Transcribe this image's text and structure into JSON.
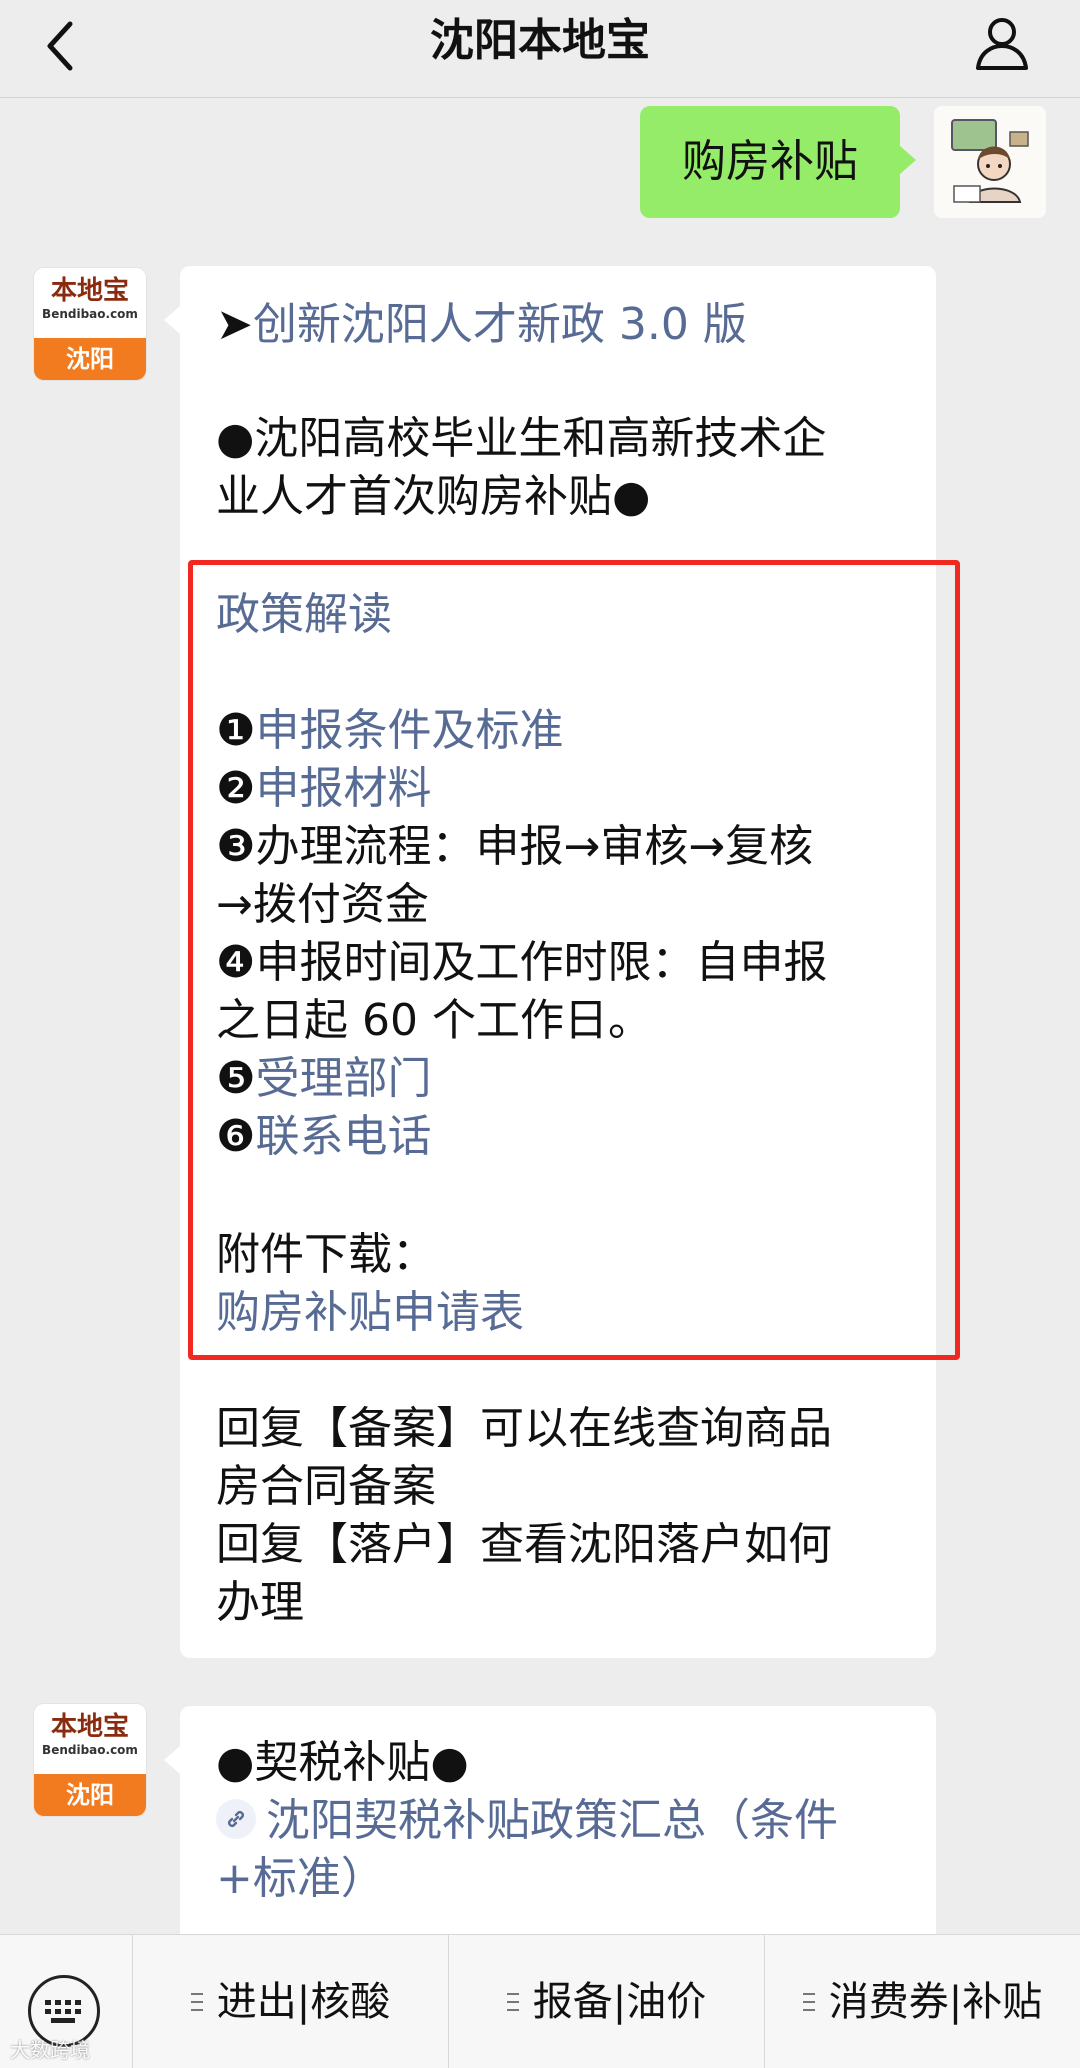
{
  "nav": {
    "title": "沈阳本地宝",
    "back_icon": "chevron-left-icon",
    "user_icon": "person-icon"
  },
  "user_message": {
    "text": "购房补贴"
  },
  "bot_avatar": {
    "brand": "本地宝",
    "domain": "Bendibao.com",
    "city": "沈阳"
  },
  "message1": {
    "arrow_mark": "➤",
    "headline_link": "创新沈阳人才新政 3.0 版",
    "subtitle_line1": "●沈阳高校毕业生和高新技术企",
    "subtitle_line2": "业人才首次购房补贴●",
    "section_title": "政策解读",
    "items": [
      {
        "num": "❶",
        "text": "申报条件及标准",
        "is_link": true
      },
      {
        "num": "❷",
        "text": "申报材料",
        "is_link": true
      },
      {
        "num": "❸",
        "text": "办理流程：申报→审核→复核",
        "is_link": false
      },
      {
        "num": "",
        "text": "→拨付资金",
        "is_link": false
      },
      {
        "num": "❹",
        "text": "申报时间及工作时限：自申报",
        "is_link": false
      },
      {
        "num": "",
        "text": "之日起 60 个工作日。",
        "is_link": false
      },
      {
        "num": "❺",
        "text": "受理部门",
        "is_link": true
      },
      {
        "num": "❻",
        "text": "联系电话",
        "is_link": true
      }
    ],
    "attachment_label": "附件下载：",
    "attachment_link": "购房补贴申请表",
    "reply_lines": [
      "回复【备案】可以在线查询商品",
      "房合同备案",
      "回复【落户】查看沈阳落户如何",
      "办理"
    ]
  },
  "message2": {
    "title": "●契税补贴●",
    "link_line1": "沈阳契税补贴政策汇总（条件",
    "link_line2": "+标准）"
  },
  "bottom_menu": {
    "keyboard_icon": "keyboard-icon",
    "items": [
      "进出|核酸",
      "报备|油价",
      "消费券|补贴"
    ]
  },
  "watermark": "大数跨境",
  "colors": {
    "link": "#576b95",
    "user_bubble": "#95ec69",
    "highlight": "#f0281f",
    "avatar_orange": "#f27a1f"
  }
}
